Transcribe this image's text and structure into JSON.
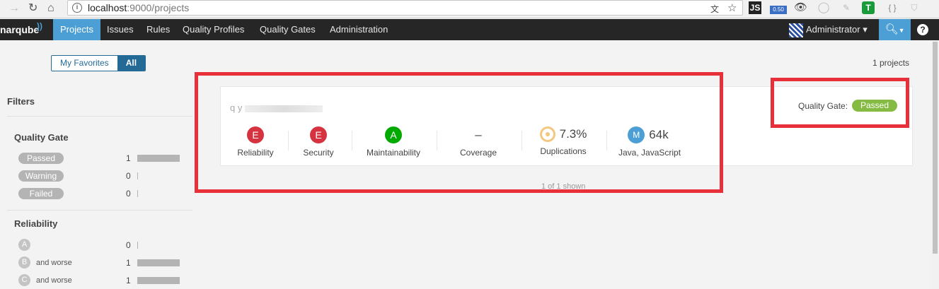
{
  "browser": {
    "url_host": "localhost",
    "url_path": ":9000/projects",
    "extensions": [
      {
        "name": "js-icon",
        "text": "JS"
      },
      {
        "name": "meter-icon",
        "text": "0.50"
      },
      {
        "name": "format-icon",
        "text": "{ }"
      }
    ]
  },
  "nav": {
    "logo": "narqube",
    "items": [
      "Projects",
      "Issues",
      "Rules",
      "Quality Profiles",
      "Quality Gates",
      "Administration"
    ],
    "active_index": 0,
    "user": "Administrator"
  },
  "toggle": {
    "favorites": "My Favorites",
    "all": "All"
  },
  "projects_count": "1 projects",
  "sidebar": {
    "title": "Filters",
    "quality_gate": {
      "title": "Quality Gate",
      "options": [
        {
          "label": "Passed",
          "count": "1",
          "fraction": 1
        },
        {
          "label": "Warning",
          "count": "0",
          "fraction": 0
        },
        {
          "label": "Failed",
          "count": "0",
          "fraction": 0
        }
      ]
    },
    "reliability": {
      "title": "Reliability",
      "options": [
        {
          "rating": "A",
          "text": "",
          "count": "0",
          "fraction": 0
        },
        {
          "rating": "B",
          "text": "and worse",
          "count": "1",
          "fraction": 1
        },
        {
          "rating": "C",
          "text": "and worse",
          "count": "1",
          "fraction": 1
        }
      ]
    }
  },
  "project": {
    "name_prefix": "q y",
    "measures": {
      "reliability": {
        "value": "E",
        "label": "Reliability"
      },
      "security": {
        "value": "E",
        "label": "Security"
      },
      "maintainability": {
        "value": "A",
        "label": "Maintainability"
      },
      "coverage": {
        "value": "–",
        "label": "Coverage"
      },
      "duplications": {
        "value": "7.3%",
        "label": "Duplications"
      },
      "size": {
        "value": "64k",
        "badge": "M",
        "label": "Java, JavaScript"
      }
    },
    "quality_gate_label": "Quality Gate:",
    "quality_gate_status": "Passed"
  },
  "shown_text": "1 of 1 shown",
  "colors": {
    "accent": "#4b9fd5",
    "rating_e": "#d4333f",
    "rating_a": "#00aa00",
    "passed": "#85bb43",
    "annotation": "#e8303b"
  }
}
